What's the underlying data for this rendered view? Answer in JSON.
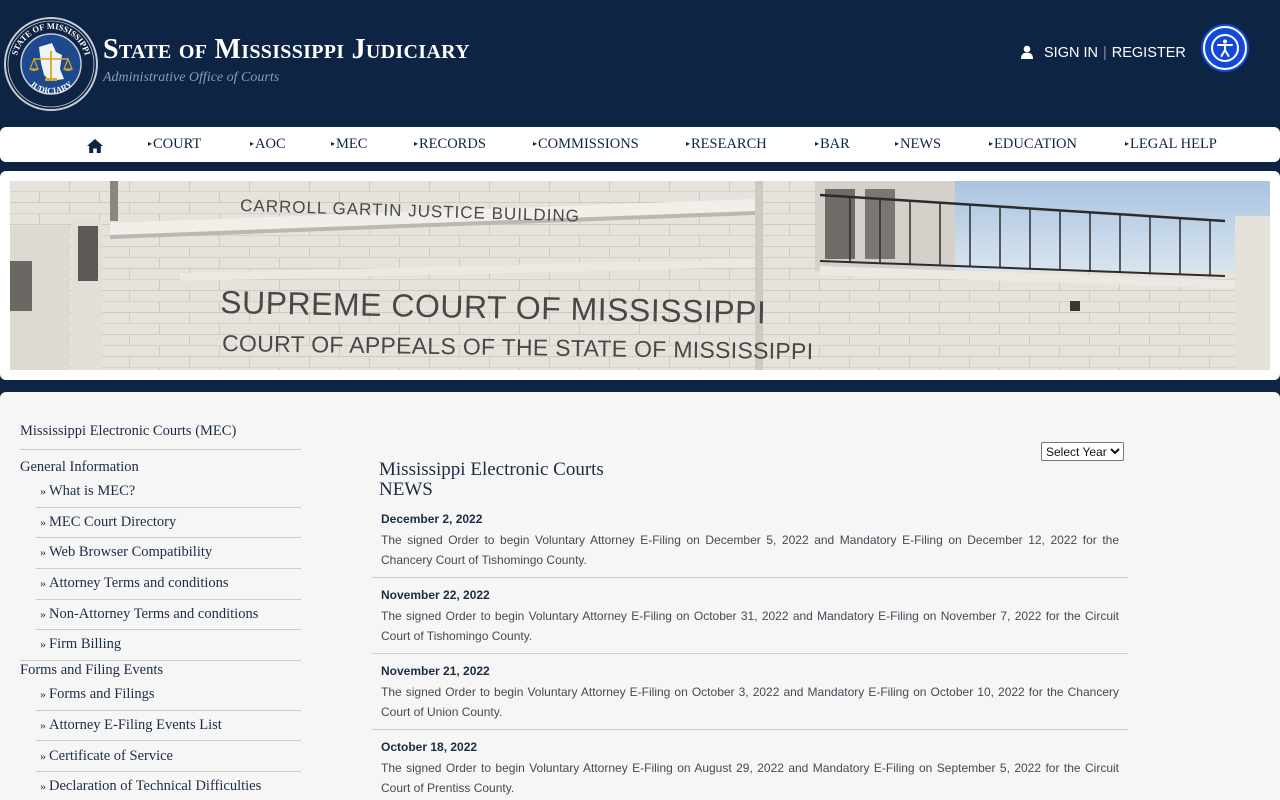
{
  "header": {
    "title": "State of Mississippi Judiciary",
    "subtitle": "Administrative Office of Courts",
    "sign_in": "SIGN IN",
    "separator": "|",
    "register": "REGISTER",
    "seal_text_top": "STATE OF MISSISSIPPI",
    "seal_text_bottom": "JUDICIARY"
  },
  "nav": {
    "items": [
      "COURT",
      "AOC",
      "MEC",
      "RECORDS",
      "COMMISSIONS",
      "RESEARCH",
      "BAR",
      "NEWS",
      "EDUCATION",
      "LEGAL HELP"
    ]
  },
  "banner": {
    "line1": "CARROLL GARTIN JUSTICE BUILDING",
    "line2": "SUPREME COURT OF MISSISSIPPI",
    "line3": "COURT OF APPEALS OF THE STATE OF MISSISSIPPI"
  },
  "sidebar": {
    "title": "Mississippi Electronic Courts (MEC)",
    "sections": [
      {
        "heading": "General Information",
        "links": [
          "What is MEC?",
          "MEC Court Directory",
          "Web Browser Compatibility",
          "Attorney Terms and conditions",
          "Non-Attorney Terms and conditions",
          "Firm Billing"
        ]
      },
      {
        "heading": "Forms and Filing Events",
        "links": [
          "Forms and Filings",
          "Attorney E-Filing Events List",
          "Certificate of Service",
          "Declaration of Technical Difficulties"
        ]
      }
    ]
  },
  "content": {
    "title_line1": "Mississippi Electronic Courts",
    "title_line2": "NEWS",
    "year_select": "Select Year",
    "news": [
      {
        "date": "December 2, 2022",
        "text": "The signed Order to begin Voluntary Attorney E-Filing on December 5, 2022 and Mandatory E-Filing on December 12, 2022 for the Chancery Court of Tishomingo County."
      },
      {
        "date": "November 22, 2022",
        "text": "The signed Order to begin Voluntary Attorney E-Filing on October 31, 2022 and Mandatory E-Filing on November 7, 2022 for the Circuit Court of Tishomingo County."
      },
      {
        "date": "November 21, 2022",
        "text": "The signed Order to begin Voluntary Attorney E-Filing on October 3, 2022 and Mandatory E-Filing on October 10, 2022 for the Chancery Court of Union County."
      },
      {
        "date": "October 18, 2022",
        "text": "The signed Order to begin Voluntary Attorney E-Filing on August 29, 2022 and Mandatory E-Filing on September 5, 2022 for the Circuit Court of Prentiss County."
      }
    ]
  },
  "colors": {
    "navy": "#0d2444",
    "accessibility_blue": "#1449d8",
    "gold": "#d4a92a"
  }
}
